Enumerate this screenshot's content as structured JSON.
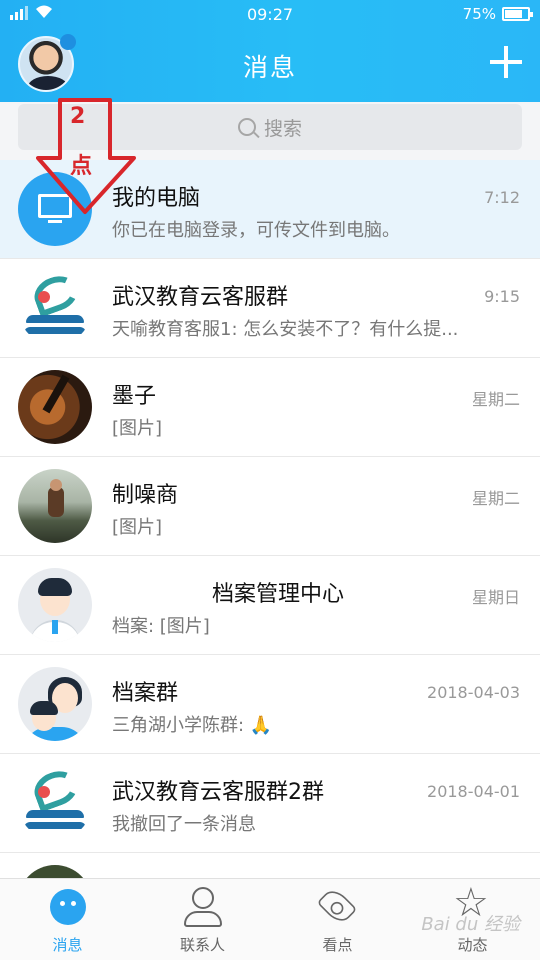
{
  "status_bar": {
    "signal": "4G",
    "time": "09:27",
    "battery": "75%",
    "battery_level": 0.75
  },
  "header": {
    "title": "消息"
  },
  "search": {
    "placeholder": "搜索"
  },
  "annotation": {
    "step": "2",
    "action": "点"
  },
  "conversations": [
    {
      "name": "我的电脑",
      "time": "7:12",
      "preview": "你已在电脑登录，可传文件到电脑。",
      "avatar": "computer-icon"
    },
    {
      "name": "武汉教育云客服群",
      "time": "9:15",
      "preview": "天喻教育客服1: 怎么安装不了？有什么提...",
      "avatar": "edu-logo"
    },
    {
      "name": "墨子",
      "time": "星期二",
      "preview": "[图片]",
      "avatar": "violin-photo"
    },
    {
      "name": "制噪商",
      "time": "星期二",
      "preview": "[图片]",
      "avatar": "outdoor-photo"
    },
    {
      "name": "档案管理中心",
      "time": "星期日",
      "preview": "档案: [图片]",
      "avatar": "person-avatar"
    },
    {
      "name": "档案群",
      "time": "2018-04-03",
      "preview": "三角湖小学陈群: 🙏",
      "avatar": "group-avatar"
    },
    {
      "name": "武汉教育云客服群2群",
      "time": "2018-04-01",
      "preview": "我撤回了一条消息",
      "avatar": "edu-logo"
    }
  ],
  "tabs": [
    {
      "label": "消息",
      "icon": "message-icon",
      "active": true
    },
    {
      "label": "联系人",
      "icon": "contacts-icon"
    },
    {
      "label": "看点",
      "icon": "eye-icon"
    },
    {
      "label": "动态",
      "icon": "star-icon"
    }
  ],
  "watermark": "Bai du 经验",
  "colors": {
    "accent": "#2aa4f0",
    "header_start": "#23b0f3",
    "annotation": "#d8262b"
  }
}
